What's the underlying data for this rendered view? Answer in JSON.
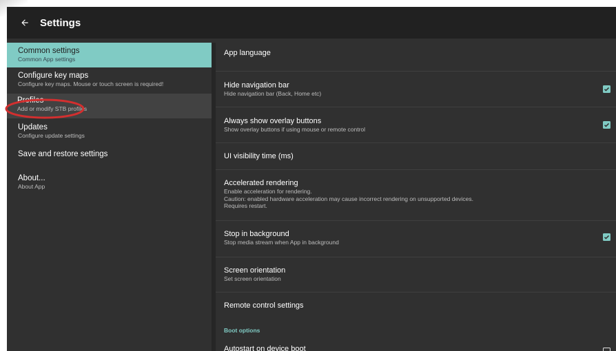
{
  "toolbar": {
    "title": "Settings",
    "back_icon": "arrow-back-icon"
  },
  "sidebar": {
    "items": [
      {
        "title": "Common settings",
        "subtitle": "Common App settings"
      },
      {
        "title": "Configure key maps",
        "subtitle": "Configure key maps. Mouse or touch screen is required!"
      },
      {
        "title": "Profiles",
        "subtitle": "Add or modify STB profiles"
      },
      {
        "title": "Updates",
        "subtitle": "Configure update settings"
      },
      {
        "title": "Save and restore settings"
      },
      {
        "title": "About...",
        "subtitle": "About App"
      }
    ]
  },
  "content": {
    "prefs": [
      {
        "title": "App language"
      },
      {
        "title": "Hide navigation bar",
        "summary": "Hide navigation bar (Back, Home etc)",
        "checked": true
      },
      {
        "title": "Always show overlay buttons",
        "summary": "Show overlay buttons if using mouse or remote control",
        "checked": true
      },
      {
        "title": "UI visibility time (ms)"
      },
      {
        "title": "Accelerated rendering",
        "summary_lines": [
          "Enable acceleration for rendering.",
          "Caution: enabled hardware acceleration may cause incorrect rendering on unsupported devices.",
          "Requires restart."
        ]
      },
      {
        "title": "Stop in background",
        "summary": "Stop media stream when App in background",
        "checked": true
      },
      {
        "title": "Screen orientation",
        "summary": "Set screen orientation"
      },
      {
        "title": "Remote control settings"
      },
      {
        "title": "Autostart on device boot",
        "checked": false
      }
    ],
    "category_boot": "Boot options"
  },
  "colors": {
    "accent": "#80cbc4",
    "toolbar": "#212121",
    "background": "#303030",
    "annotation": "#d32f2f"
  }
}
